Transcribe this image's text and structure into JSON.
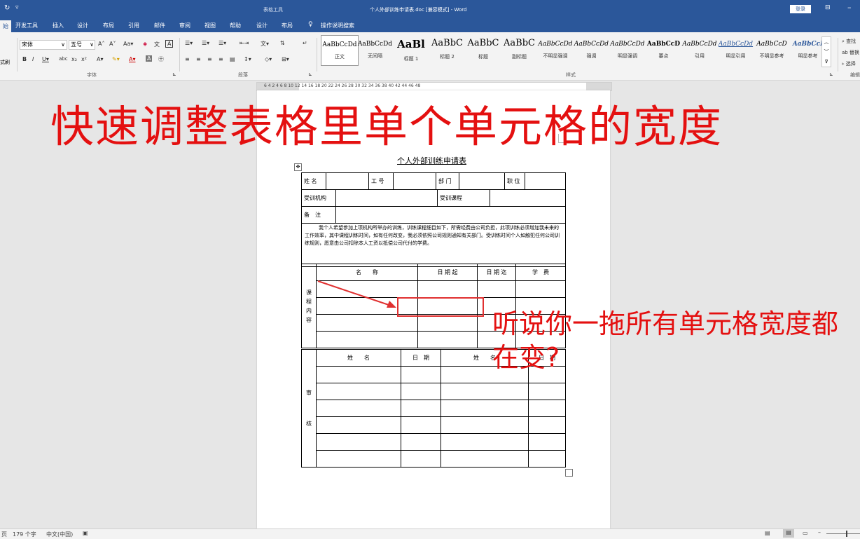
{
  "window": {
    "title": "个人外部训练申请表.doc [兼容模式] - Word",
    "context_tool": "表格工具",
    "login": "登录",
    "quick_access": "▿"
  },
  "tabs": [
    "开发工具",
    "插入",
    "设计",
    "布局",
    "引用",
    "邮件",
    "审阅",
    "视图",
    "帮助",
    "设计",
    "布局"
  ],
  "tell_me": "操作说明搜索",
  "ribbon": {
    "font_name": "宋体",
    "font_size": "五号",
    "group_font": "字体",
    "group_paragraph": "段落",
    "group_styles": "样式",
    "group_edit": "编辑",
    "left_cut": "式刷",
    "styles": [
      {
        "sample": "AaBbCcDd",
        "name": "正文"
      },
      {
        "sample": "AaBbCcDd",
        "name": "无间隔"
      },
      {
        "sample": "AaBl",
        "name": "标题 1"
      },
      {
        "sample": "AaBbC",
        "name": "标题 2"
      },
      {
        "sample": "AaBbC",
        "name": "标题"
      },
      {
        "sample": "AaBbC",
        "name": "副标题"
      },
      {
        "sample": "AaBbCcDd",
        "name": "不明显强调"
      },
      {
        "sample": "AaBbCcDd",
        "name": "强调"
      },
      {
        "sample": "AaBbCcDd",
        "name": "明显强调"
      },
      {
        "sample": "AaBbCcD",
        "name": "要点"
      },
      {
        "sample": "AaBbCcDd",
        "name": "引用"
      },
      {
        "sample": "AaBbCcDd",
        "name": "明显引用"
      },
      {
        "sample": "AaBbCcD",
        "name": "不明显参考"
      },
      {
        "sample": "AaBbCcI",
        "name": "明显参考"
      }
    ],
    "right_items": [
      "查找",
      "替换",
      "选择"
    ]
  },
  "ruler": "6  4  2     4  6  8  10  12  14  16  18  20  22  24  26  28  30  32  34  36  38  40  42  44  46  48",
  "overlay": {
    "title": "快速调整表格里单个单元格的宽度",
    "note": "听说你一拖所有单元格宽度都在变?"
  },
  "form": {
    "title": "个人外部训练申请表",
    "row1": [
      "姓 名",
      "",
      "工 号",
      "",
      "部 门",
      "",
      "职 位",
      ""
    ],
    "row2": [
      "受训机构",
      "",
      "受训课程",
      ""
    ],
    "row3_label": "备　注",
    "statement": "我个人希望参加上项机构所举办的训练，训练课程细目如下，所需经费由公司负担，此项训练必须增加我未来的工作效率，其中课程训练时间，如有任何改变，我必须依照公司规则通知有关部门。受训练时间个人如触犯任何公司训练规则，愿意由公司扣除本人工资以抵偿公司代付的学费。",
    "course_label": "课程内容",
    "course_headers": [
      "名　　称",
      "日 期 起",
      "日 期 迄",
      "学　费"
    ],
    "review_label_1": "审",
    "review_label_2": "核",
    "review_headers": [
      "姓　　名",
      "日　期",
      "姓　　名",
      "日　期"
    ]
  },
  "status": {
    "page": "页",
    "word_count": "179 个字",
    "language": "中文(中国)"
  },
  "colors": {
    "accent": "#2b579a",
    "annotation": "#e41010"
  }
}
